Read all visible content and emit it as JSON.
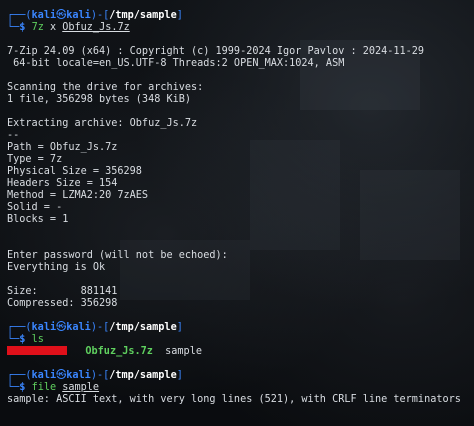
{
  "prompt": {
    "user": "kali",
    "host": "kali",
    "at": "㉿",
    "dir": "/tmp/sample",
    "symbol": "$"
  },
  "commands": {
    "cmd1_bin": "7z",
    "cmd1_args": "x",
    "cmd1_file": "Obfuz_Js.7z",
    "cmd2_bin": "ls",
    "cmd3_bin": "file",
    "cmd3_arg": "sample"
  },
  "output": {
    "version_line": "7-Zip 24.09 (x64) : Copyright (c) 1999-2024 Igor Pavlov : 2024-11-29",
    "locale_line": " 64-bit locale=en_US.UTF-8 Threads:2 OPEN_MAX:1024, ASM",
    "scanning": "Scanning the drive for archives:",
    "files_found": "1 file, 356298 bytes (348 KiB)",
    "extracting": "Extracting archive: Obfuz_Js.7z",
    "separator": "--",
    "path": "Path = Obfuz_Js.7z",
    "type": "Type = 7z",
    "physical_size": "Physical Size = 356298",
    "headers_size": "Headers Size = 154",
    "method": "Method = LZMA2:20 7zAES",
    "solid": "Solid = -",
    "blocks": "Blocks = 1",
    "enter_password": "Enter password (will not be echoed):",
    "everything_ok": "Everything is Ok",
    "size": "Size:       881141",
    "compressed": "Compressed: 356298",
    "ls_archive": "Obfuz_Js.7z",
    "ls_dir": "sample",
    "file_result": "sample: ASCII text, with very long lines (521), with CRLF line terminators"
  },
  "colors": {
    "prompt_frame": "#3a86ff",
    "path": "#ffffff",
    "command": "#5fd05f",
    "redaction": "#e0101a",
    "background": "#0b0e11"
  }
}
